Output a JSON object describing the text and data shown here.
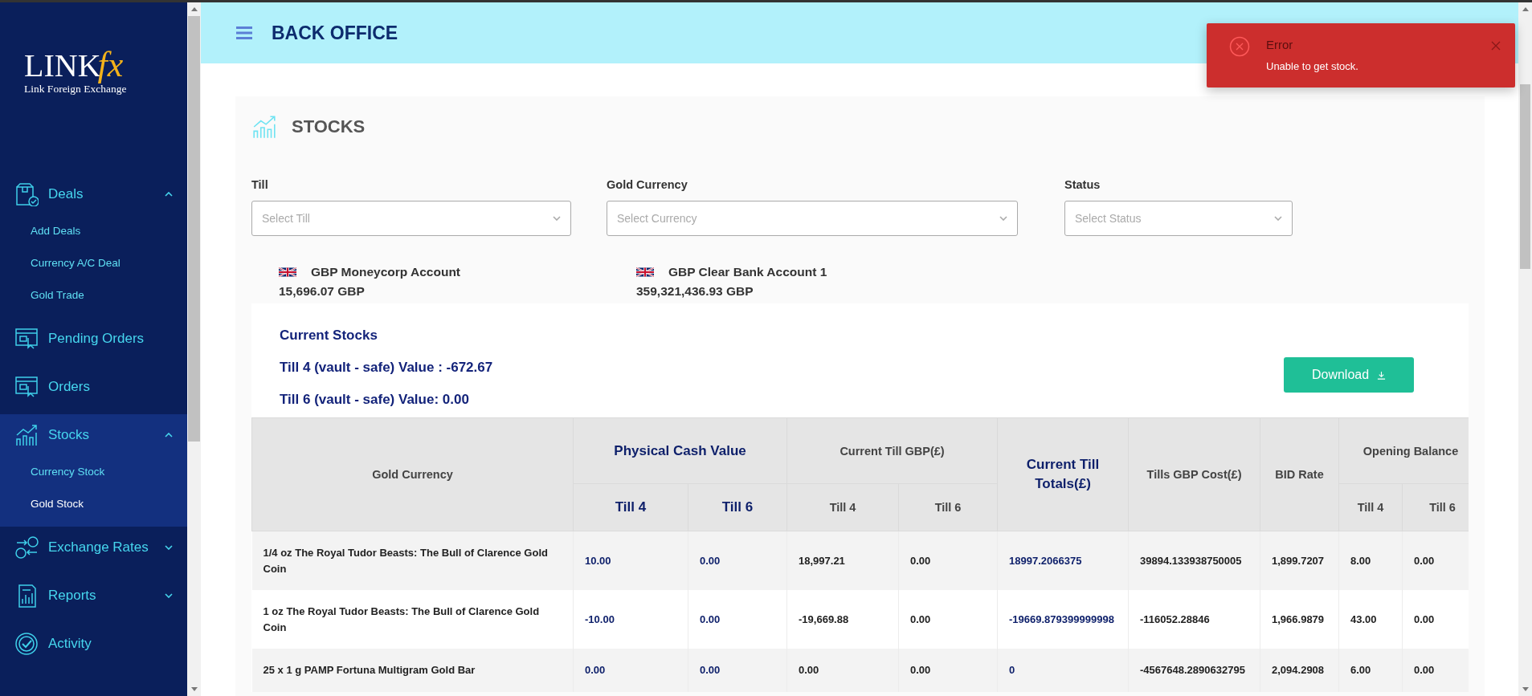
{
  "sidebar": {
    "logo": {
      "wordmark": "LINK",
      "accent": "fx",
      "tagline": "Link Foreign Exchange"
    },
    "items": [
      {
        "label": "Deals",
        "expanded": true,
        "selected": false,
        "children": [
          {
            "label": "Add Deals",
            "selected": false
          },
          {
            "label": "Currency A/C Deal",
            "selected": false
          },
          {
            "label": "Gold Trade",
            "selected": false
          }
        ]
      },
      {
        "label": "Pending Orders",
        "selected": false
      },
      {
        "label": "Orders",
        "selected": false
      },
      {
        "label": "Stocks",
        "expanded": true,
        "selected": true,
        "children": [
          {
            "label": "Currency Stock",
            "selected": false
          },
          {
            "label": "Gold Stock",
            "selected": true
          }
        ]
      },
      {
        "label": "Exchange Rates",
        "expanded": false,
        "selected": false
      },
      {
        "label": "Reports",
        "expanded": false,
        "selected": false
      },
      {
        "label": "Activity",
        "selected": false
      }
    ]
  },
  "header": {
    "title": "BACK OFFICE"
  },
  "toast": {
    "kind": "error",
    "title": "Error",
    "message": "Unable to get stock."
  },
  "page": {
    "title": "STOCKS",
    "filters": [
      {
        "label": "Till",
        "placeholder": "Select Till"
      },
      {
        "label": "Gold Currency",
        "placeholder": "Select Currency"
      },
      {
        "label": "Status",
        "placeholder": "Select Status"
      }
    ],
    "accounts": [
      {
        "name": "GBP Moneycorp Account",
        "amount": "15,696.07 GBP"
      },
      {
        "name": "GBP Clear Bank Account 1",
        "amount": "359,321,436.93 GBP"
      }
    ],
    "current_stocks": {
      "title": "Current Stocks",
      "lines": [
        "Till 4 (vault - safe) Value : -672.67",
        "Till 6 (vault - safe) Value: 0.00"
      ]
    },
    "download_button": "Download",
    "table": {
      "column_groups": [
        {
          "label": "Gold Currency",
          "kind": "plain"
        },
        {
          "label": "Physical Cash Value",
          "kind": "emphasis",
          "columns": [
            {
              "label": "Till 4"
            },
            {
              "label": "Till 6"
            }
          ]
        },
        {
          "label": "Current Till GBP(£)",
          "kind": "plain",
          "columns": [
            {
              "label": "Till 4"
            },
            {
              "label": "Till 6"
            }
          ]
        },
        {
          "label": "Current Till Totals(£)",
          "kind": "emphasis"
        },
        {
          "label": "Tills GBP Cost(£)",
          "kind": "plain"
        },
        {
          "label": "BID Rate",
          "kind": "plain"
        },
        {
          "label": "Opening Balance",
          "kind": "plain",
          "columns": [
            {
              "label": "Till 4"
            },
            {
              "label": "Till 6"
            }
          ]
        }
      ],
      "rows": [
        [
          "1/4 oz The Royal Tudor Beasts: The Bull of Clarence Gold Coin",
          "10.00",
          "0.00",
          "18,997.21",
          "0.00",
          "18997.2066375",
          "39894.133938750005",
          "1,899.7207",
          "8.00",
          "0.00"
        ],
        [
          "1 oz The Royal Tudor Beasts: The Bull of Clarence Gold Coin",
          "-10.00",
          "0.00",
          "-19,669.88",
          "0.00",
          "-19669.879399999998",
          "-116052.28846",
          "1,966.9879",
          "43.00",
          "0.00"
        ],
        [
          "25 x 1 g PAMP Fortuna Multigram Gold Bar",
          "0.00",
          "0.00",
          "0.00",
          "0.00",
          "0",
          "-4567648.2890632795",
          "2,094.2908",
          "6.00",
          "0.00"
        ]
      ]
    }
  }
}
